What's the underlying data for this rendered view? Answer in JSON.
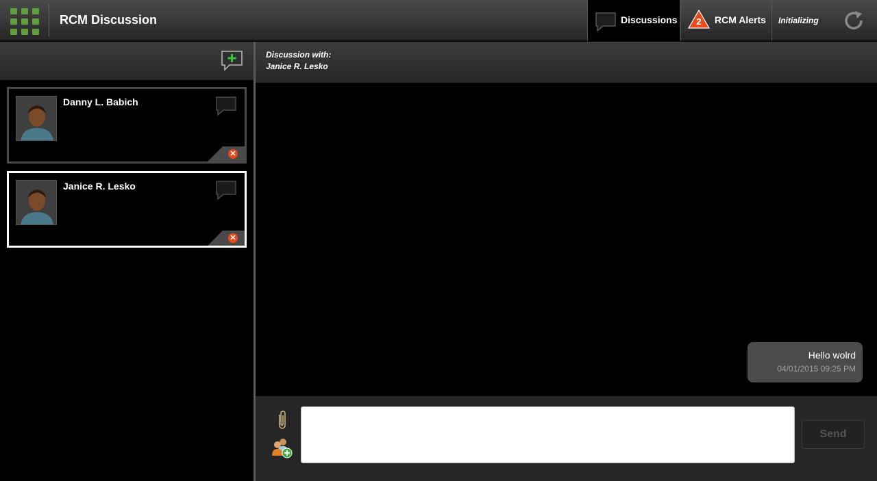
{
  "header": {
    "app_title": "RCM Discussion",
    "apps_icon": "grid-apps-icon",
    "discussions_tab_label": "Discussions",
    "alerts_tab_label": "RCM Alerts",
    "alerts_count": "2",
    "status_text": "Initializing",
    "refresh_icon": "refresh-icon",
    "accent_color": "#5f9e3c",
    "alert_color": "#e84a1a"
  },
  "sidebar": {
    "new_discussion_icon": "new-discussion-icon",
    "contacts": [
      {
        "name": "Danny L. Babich",
        "selected": false
      },
      {
        "name": "Janice R. Lesko",
        "selected": true
      }
    ]
  },
  "main": {
    "header_line1": "Discussion with:",
    "header_line2": "Janice R. Lesko",
    "messages": [
      {
        "text": "Hello wolrd",
        "time": "04/01/2015 09:25 PM"
      }
    ]
  },
  "compose": {
    "input_value": "",
    "send_label": "Send",
    "attach_icon": "paperclip-icon",
    "add_user_icon": "add-user-icon"
  }
}
